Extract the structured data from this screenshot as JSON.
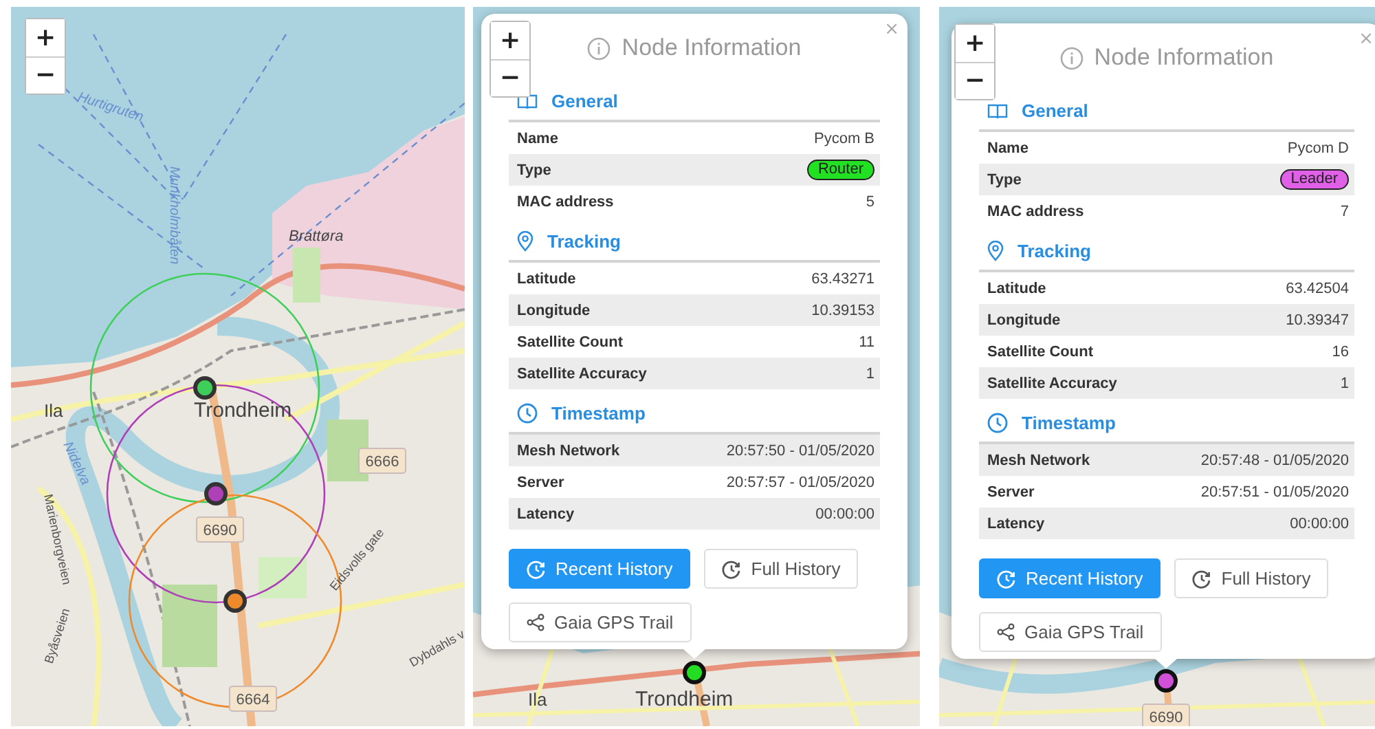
{
  "map": {
    "zoom_in": "+",
    "zoom_out": "−",
    "labels": [
      {
        "text": "Hurtigruten",
        "kind": "route"
      },
      {
        "text": "Munkholmbåten",
        "kind": "route"
      },
      {
        "text": "Brattøra",
        "kind": "district"
      },
      {
        "text": "Ila",
        "kind": "place"
      },
      {
        "text": "Trondheim",
        "kind": "city"
      },
      {
        "text": "Nidelva",
        "kind": "route"
      },
      {
        "text": "Marienborgveien",
        "kind": "street"
      },
      {
        "text": "Byåsveien",
        "kind": "street"
      },
      {
        "text": "Eidsvolls gate",
        "kind": "street"
      },
      {
        "text": "Dybdahls v",
        "kind": "street"
      },
      {
        "text": "6666",
        "kind": "road_number"
      },
      {
        "text": "6690",
        "kind": "road_number"
      },
      {
        "text": "6664",
        "kind": "road_number"
      }
    ],
    "nodes": [
      {
        "color": "#3ecf5a"
      },
      {
        "color": "#b040b8"
      },
      {
        "color": "#ee8a2c"
      }
    ]
  },
  "popups": [
    {
      "zoom_in": "+",
      "zoom_out": "−",
      "close": "×",
      "title": "Node Information",
      "sections": [
        {
          "title": "General",
          "rows": [
            {
              "label": "Name",
              "value": "Pycom B",
              "shaded": false
            },
            {
              "label": "Type",
              "badge": {
                "text": "Router",
                "color": "#22e022"
              },
              "shaded": true
            },
            {
              "label": "MAC address",
              "value": "5",
              "shaded": false
            }
          ]
        },
        {
          "title": "Tracking",
          "rows": [
            {
              "label": "Latitude",
              "value": "63.43271",
              "shaded": false
            },
            {
              "label": "Longitude",
              "value": "10.39153",
              "shaded": true
            },
            {
              "label": "Satellite Count",
              "value": "11",
              "shaded": false
            },
            {
              "label": "Satellite Accuracy",
              "value": "1",
              "shaded": true
            }
          ]
        },
        {
          "title": "Timestamp",
          "rows": [
            {
              "label": "Mesh Network",
              "value": "20:57:50 - 01/05/2020",
              "shaded": true
            },
            {
              "label": "Server",
              "value": "20:57:57 - 01/05/2020",
              "shaded": false
            },
            {
              "label": "Latency",
              "value": "00:00:00",
              "shaded": true
            }
          ]
        }
      ],
      "buttons": [
        {
          "label": "Recent History",
          "primary": true
        },
        {
          "label": "Full History",
          "primary": false
        },
        {
          "label": "Gaia GPS Trail",
          "primary": false
        }
      ],
      "marker": {
        "color": "#22dd22"
      },
      "map_labels": [
        {
          "text": "Ila",
          "kind": "place"
        },
        {
          "text": "Trondheim",
          "kind": "city"
        }
      ]
    },
    {
      "zoom_in": "+",
      "zoom_out": "−",
      "close": "×",
      "title": "Node Information",
      "sections": [
        {
          "title": "General",
          "rows": [
            {
              "label": "Name",
              "value": "Pycom D",
              "shaded": false
            },
            {
              "label": "Type",
              "badge": {
                "text": "Leader",
                "color": "#e060e8"
              },
              "shaded": true
            },
            {
              "label": "MAC address",
              "value": "7",
              "shaded": false
            }
          ]
        },
        {
          "title": "Tracking",
          "rows": [
            {
              "label": "Latitude",
              "value": "63.42504",
              "shaded": false
            },
            {
              "label": "Longitude",
              "value": "10.39347",
              "shaded": true
            },
            {
              "label": "Satellite Count",
              "value": "16",
              "shaded": false
            },
            {
              "label": "Satellite Accuracy",
              "value": "1",
              "shaded": true
            }
          ]
        },
        {
          "title": "Timestamp",
          "rows": [
            {
              "label": "Mesh Network",
              "value": "20:57:48 - 01/05/2020",
              "shaded": true
            },
            {
              "label": "Server",
              "value": "20:57:51 - 01/05/2020",
              "shaded": false
            },
            {
              "label": "Latency",
              "value": "00:00:00",
              "shaded": true
            }
          ]
        }
      ],
      "buttons": [
        {
          "label": "Recent History",
          "primary": true
        },
        {
          "label": "Full History",
          "primary": false
        },
        {
          "label": "Gaia GPS Trail",
          "primary": false
        }
      ],
      "marker": {
        "color": "#d050d8"
      },
      "map_labels": [
        {
          "text": "6690",
          "kind": "road_number"
        }
      ]
    }
  ]
}
